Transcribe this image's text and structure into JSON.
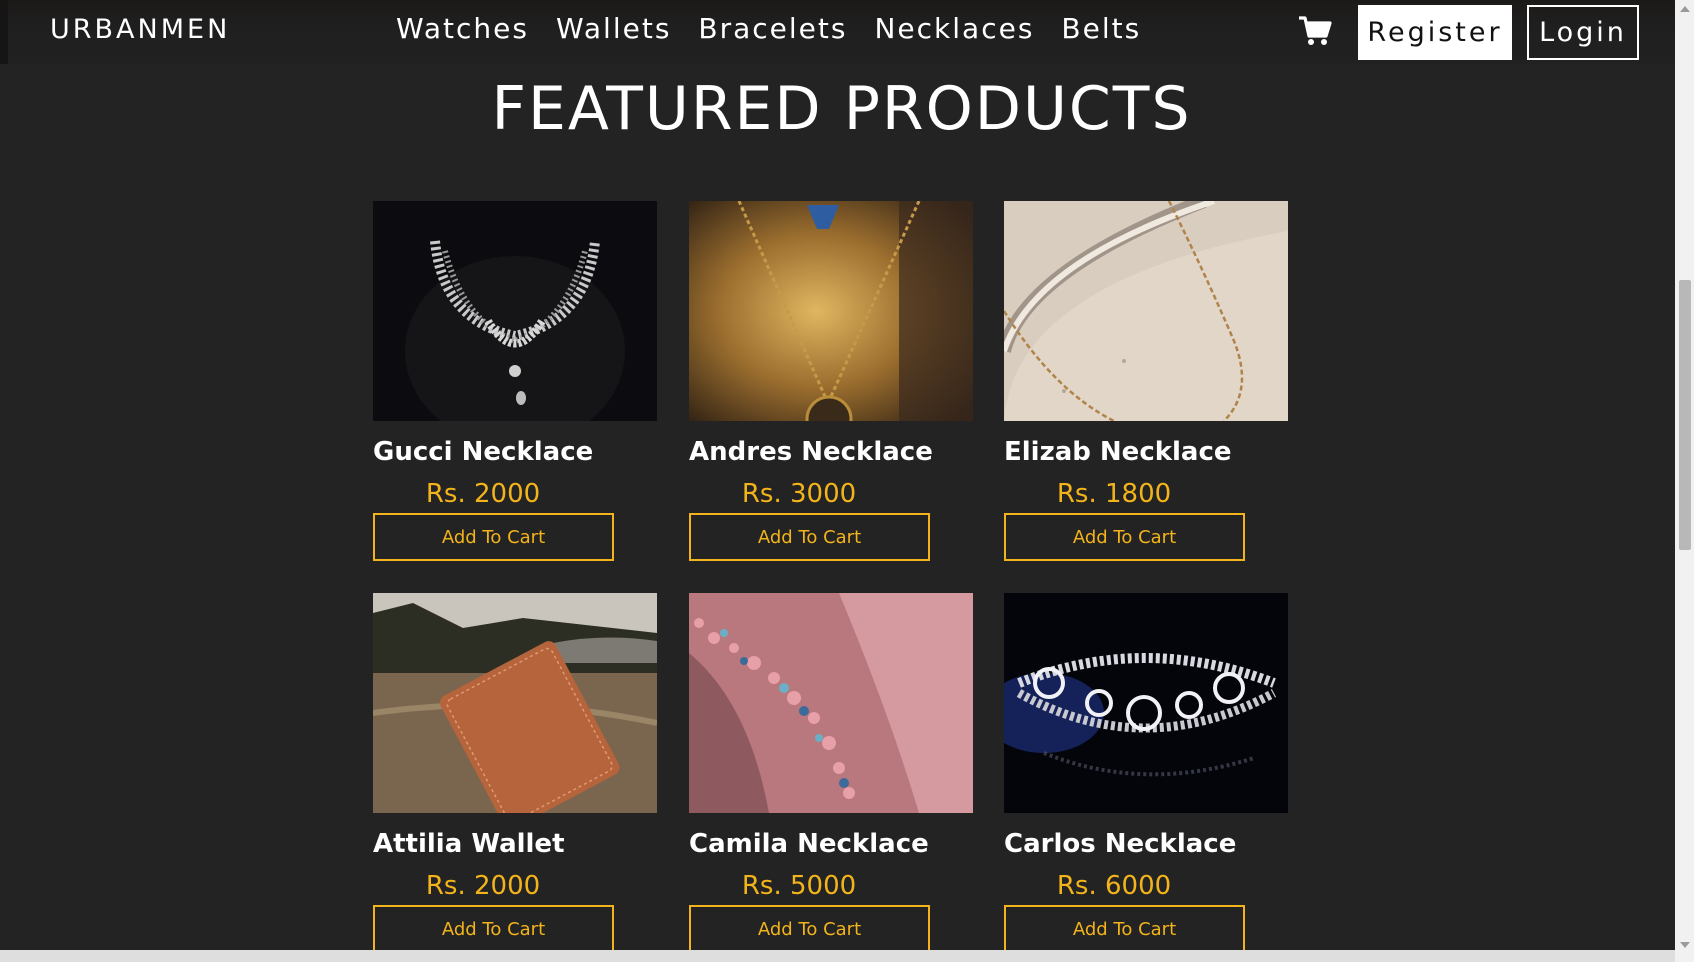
{
  "nav": {
    "brand": "URBANMEN",
    "links": [
      "Watches",
      "Wallets",
      "Bracelets",
      "Necklaces",
      "Belts"
    ],
    "cart_icon": "shopping-cart-icon",
    "register_label": "Register",
    "login_label": "Login"
  },
  "main": {
    "title": "FEATURED PRODUCTS",
    "products": [
      {
        "name": "Gucci Necklace",
        "price": "Rs. 2000",
        "button": "Add To Cart"
      },
      {
        "name": "Andres Necklace",
        "price": "Rs. 3000",
        "button": "Add To Cart"
      },
      {
        "name": "Elizab Necklace",
        "price": "Rs. 1800",
        "button": "Add To Cart"
      },
      {
        "name": "Attilia Wallet",
        "price": "Rs. 2000",
        "button": "Add To Cart"
      },
      {
        "name": "Camila Necklace",
        "price": "Rs. 5000",
        "button": "Add To Cart"
      },
      {
        "name": "Carlos Necklace",
        "price": "Rs. 6000",
        "button": "Add To Cart"
      }
    ]
  },
  "colors": {
    "background": "#232323",
    "accent": "#f2b31b",
    "text": "#ffffff"
  }
}
